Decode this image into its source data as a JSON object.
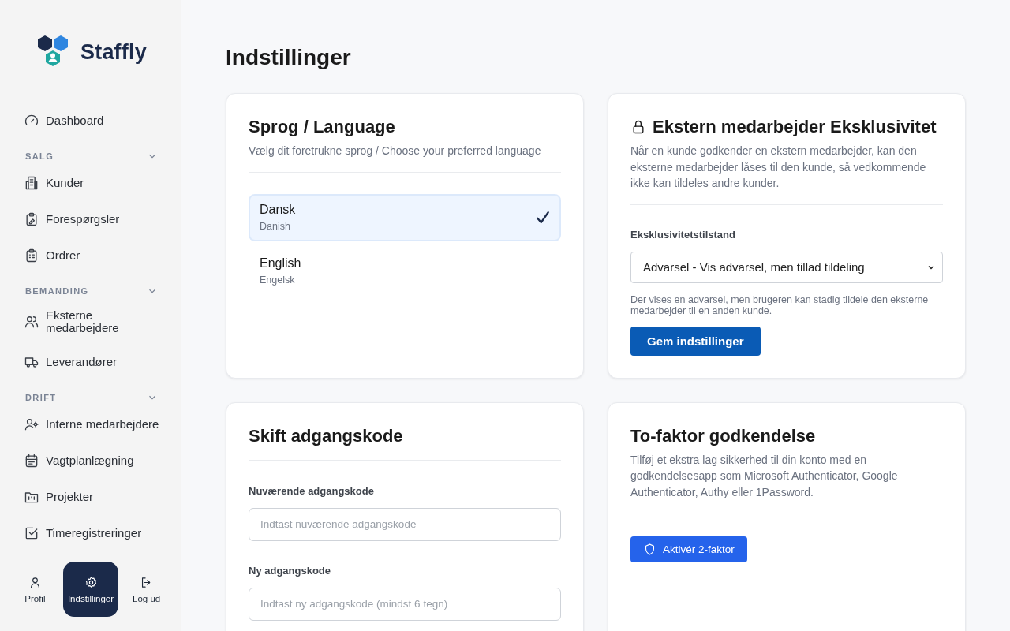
{
  "brand": {
    "name": "Staffly"
  },
  "sidebar": {
    "items": [
      {
        "kind": "link",
        "label": "Dashboard"
      },
      {
        "kind": "section",
        "label": "SALG",
        "expanded": true,
        "children": [
          {
            "label": "Kunder"
          },
          {
            "label": "Forespørgsler"
          },
          {
            "label": "Ordrer"
          }
        ]
      },
      {
        "kind": "section",
        "label": "BEMANDING",
        "expanded": true,
        "children": [
          {
            "label": "Eksterne medarbejdere"
          },
          {
            "label": "Leverandører"
          }
        ]
      },
      {
        "kind": "section",
        "label": "DRIFT",
        "expanded": true,
        "children": [
          {
            "label": "Interne medarbejdere"
          },
          {
            "label": "Vagtplanlægning"
          },
          {
            "label": "Projekter"
          },
          {
            "label": "Timeregistreringer"
          }
        ]
      }
    ],
    "footer": [
      {
        "label": "Profil",
        "selected": false
      },
      {
        "label": "Indstillinger",
        "selected": true
      },
      {
        "label": "Log ud",
        "selected": false
      }
    ]
  },
  "page": {
    "title": "Indstillinger"
  },
  "language_card": {
    "title": "Sprog / Language",
    "subtitle": "Vælg dit foretrukne sprog / Choose your preferred language",
    "options": [
      {
        "label": "Dansk",
        "sublabel": "Danish",
        "selected": true
      },
      {
        "label": "English",
        "sublabel": "Engelsk",
        "selected": false
      }
    ]
  },
  "exclusivity_card": {
    "title": "Ekstern medarbejder Eksklusivitet",
    "description": "Når en kunde godkender en ekstern medarbejder, kan den eksterne medarbejder låses til den kunde, så vedkommende ikke kan tildeles andre kunder.",
    "field_label": "Eksklusivitetstilstand",
    "select_value": "Advarsel - Vis advarsel, men tillad tildeling",
    "help": "Der vises en advarsel, men brugeren kan stadig tildele den eksterne medarbejder til en anden kunde.",
    "button": "Gem indstillinger"
  },
  "password_card": {
    "title": "Skift adgangskode",
    "fields": [
      {
        "label": "Nuværende adgangskode",
        "placeholder": "Indtast nuværende adgangskode"
      },
      {
        "label": "Ny adgangskode",
        "placeholder": "Indtast ny adgangskode (mindst 6 tegn)"
      }
    ]
  },
  "twofactor_card": {
    "title": "To-faktor godkendelse",
    "description": "Tilføj et ekstra lag sikkerhed til din konto med en godkendelsesapp som Microsoft Authenticator, Google Authenticator, Authy eller 1Password.",
    "button": "Aktivér 2-faktor"
  }
}
